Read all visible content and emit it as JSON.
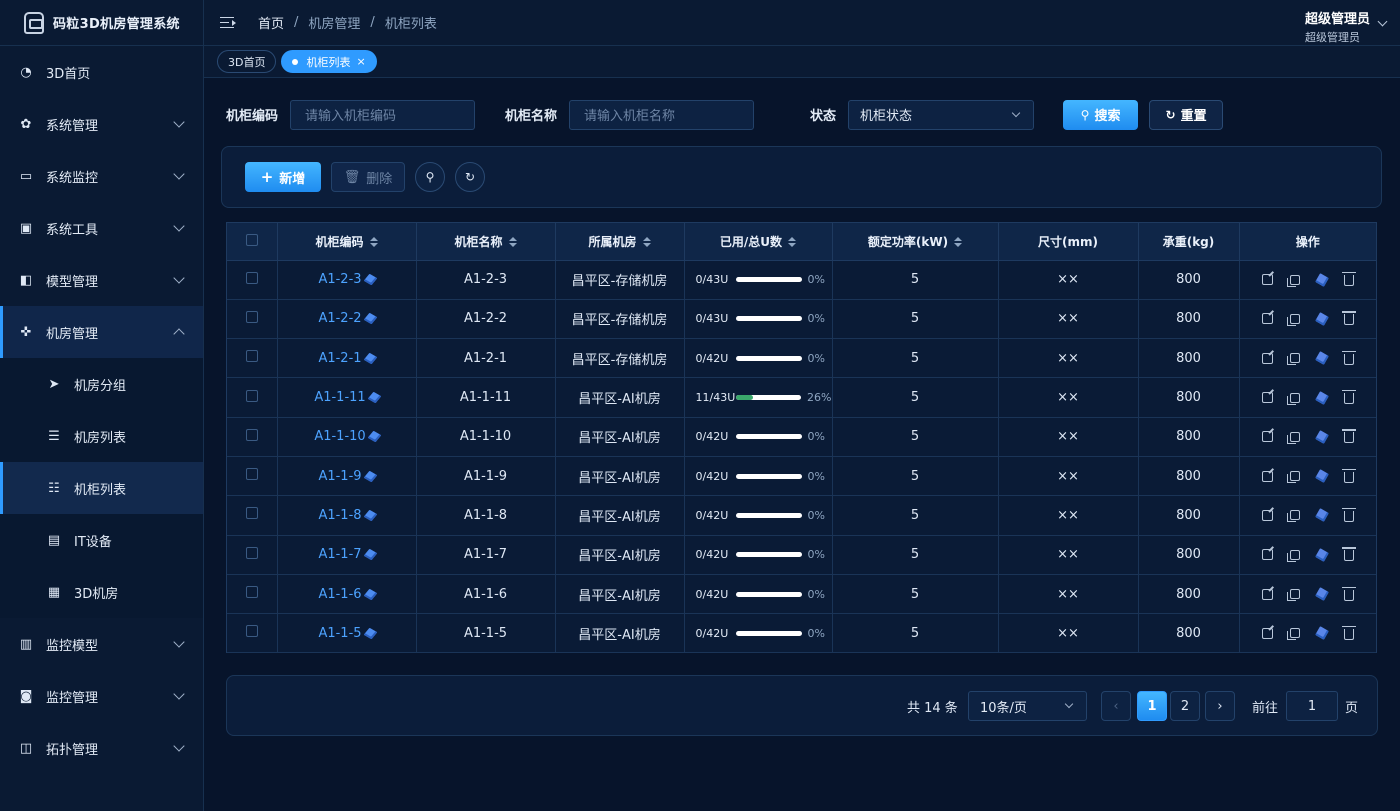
{
  "app": {
    "title": "码粒3D机房管理系统"
  },
  "sidebar": {
    "items": [
      {
        "label": "3D首页",
        "icon": "dashboard-icon"
      },
      {
        "label": "系统管理",
        "icon": "gear-icon"
      },
      {
        "label": "系统监控",
        "icon": "monitor-icon"
      },
      {
        "label": "系统工具",
        "icon": "toolbox-icon"
      },
      {
        "label": "模型管理",
        "icon": "model-icon"
      },
      {
        "label": "机房管理",
        "icon": "target-icon"
      },
      {
        "label": "监控模型",
        "icon": "server-icon"
      },
      {
        "label": "监控管理",
        "icon": "camera-icon"
      },
      {
        "label": "拓扑管理",
        "icon": "topology-icon"
      }
    ],
    "submenu": [
      {
        "label": "机房分组",
        "icon": "send-icon"
      },
      {
        "label": "机房列表",
        "icon": "list-icon"
      },
      {
        "label": "机柜列表",
        "icon": "tree-list-icon"
      },
      {
        "label": "IT设备",
        "icon": "device-icon"
      },
      {
        "label": "3D机房",
        "icon": "room-3d-icon"
      }
    ]
  },
  "header": {
    "breadcrumb": [
      "首页",
      "机房管理",
      "机柜列表"
    ],
    "user_name": "超级管理员",
    "user_role": "超级管理员"
  },
  "tags": {
    "home": "3D首页",
    "current": "机柜列表",
    "close": "×"
  },
  "filter": {
    "code_label": "机柜编码",
    "code_placeholder": "请输入机柜编码",
    "name_label": "机柜名称",
    "name_placeholder": "请输入机柜名称",
    "status_label": "状态",
    "status_value": "机柜状态",
    "search_label": "搜索",
    "reset_label": "重置"
  },
  "toolbar": {
    "add_label": "新增",
    "delete_label": "删除"
  },
  "table": {
    "columns": [
      "机柜编码",
      "机柜名称",
      "所属机房",
      "已用/总U数",
      "额定功率(kW)",
      "尺寸(mm)",
      "承重(kg)",
      "操作"
    ],
    "rows": [
      {
        "code": "A1-2-3",
        "name": "A1-2-3",
        "room": "昌平区-存储机房",
        "used": "0/43U",
        "pct": "0%",
        "fill": 0,
        "power": "5",
        "size": "××",
        "weight": "800"
      },
      {
        "code": "A1-2-2",
        "name": "A1-2-2",
        "room": "昌平区-存储机房",
        "used": "0/43U",
        "pct": "0%",
        "fill": 0,
        "power": "5",
        "size": "××",
        "weight": "800"
      },
      {
        "code": "A1-2-1",
        "name": "A1-2-1",
        "room": "昌平区-存储机房",
        "used": "0/42U",
        "pct": "0%",
        "fill": 0,
        "power": "5",
        "size": "××",
        "weight": "800"
      },
      {
        "code": "A1-1-11",
        "name": "A1-1-11",
        "room": "昌平区-AI机房",
        "used": "11/43U",
        "pct": "26%",
        "fill": 26,
        "power": "5",
        "size": "××",
        "weight": "800"
      },
      {
        "code": "A1-1-10",
        "name": "A1-1-10",
        "room": "昌平区-AI机房",
        "used": "0/42U",
        "pct": "0%",
        "fill": 0,
        "power": "5",
        "size": "××",
        "weight": "800"
      },
      {
        "code": "A1-1-9",
        "name": "A1-1-9",
        "room": "昌平区-AI机房",
        "used": "0/42U",
        "pct": "0%",
        "fill": 0,
        "power": "5",
        "size": "××",
        "weight": "800"
      },
      {
        "code": "A1-1-8",
        "name": "A1-1-8",
        "room": "昌平区-AI机房",
        "used": "0/42U",
        "pct": "0%",
        "fill": 0,
        "power": "5",
        "size": "××",
        "weight": "800"
      },
      {
        "code": "A1-1-7",
        "name": "A1-1-7",
        "room": "昌平区-AI机房",
        "used": "0/42U",
        "pct": "0%",
        "fill": 0,
        "power": "5",
        "size": "××",
        "weight": "800"
      },
      {
        "code": "A1-1-6",
        "name": "A1-1-6",
        "room": "昌平区-AI机房",
        "used": "0/42U",
        "pct": "0%",
        "fill": 0,
        "power": "5",
        "size": "××",
        "weight": "800"
      },
      {
        "code": "A1-1-5",
        "name": "A1-1-5",
        "room": "昌平区-AI机房",
        "used": "0/42U",
        "pct": "0%",
        "fill": 0,
        "power": "5",
        "size": "××",
        "weight": "800"
      }
    ]
  },
  "pagination": {
    "total": "共 14 条",
    "page_size": "10条/页",
    "pages": [
      "1",
      "2"
    ],
    "current": "1",
    "goto_label": "前往",
    "goto_value": "1",
    "goto_unit": "页"
  },
  "colors": {
    "accent": "#2f9bff",
    "background": "#07142b",
    "panel": "#0b1d3a",
    "link": "#4da3ff",
    "progress": "#3aa86b"
  }
}
